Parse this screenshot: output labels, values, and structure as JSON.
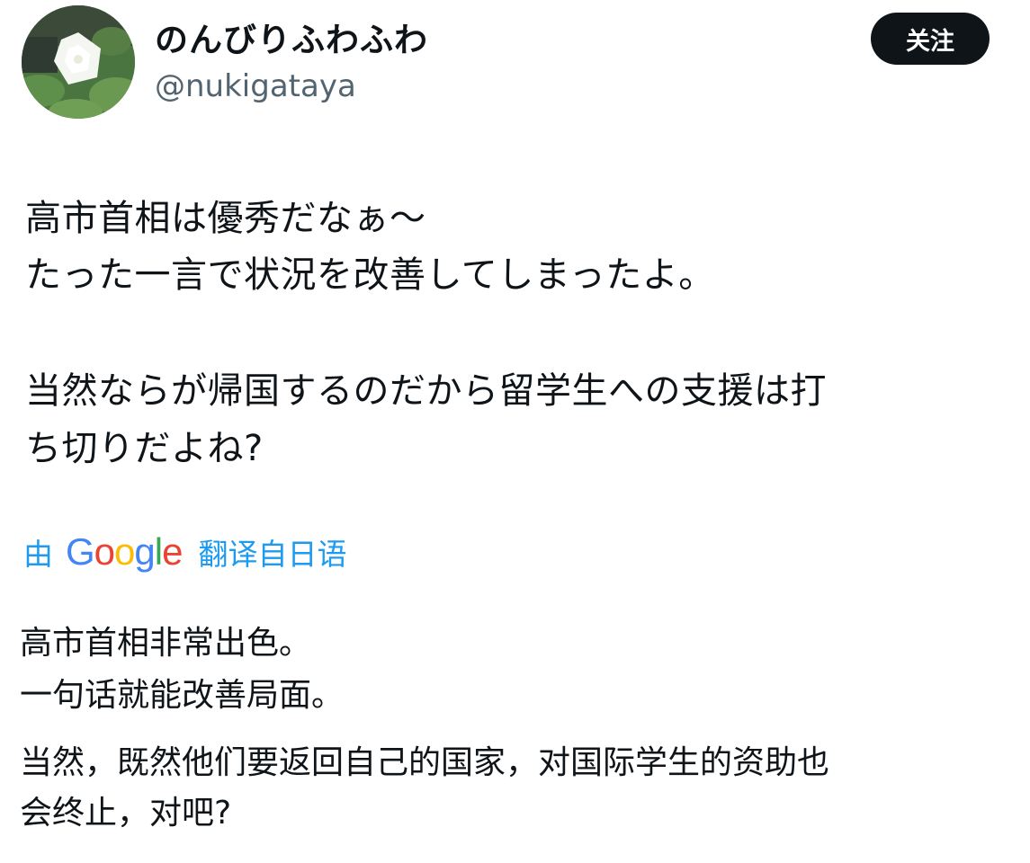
{
  "user": {
    "display_name": "のんびりふわふわ",
    "handle": "@nukigataya"
  },
  "follow_button": {
    "label": "关注"
  },
  "tweet": {
    "lines": [
      "高市首相は優秀だなぁ～",
      "たった一言で状況を改善してしまったよ。",
      "当然ならが帰国するのだから留学生への支援は打",
      "ち切りだよね?"
    ]
  },
  "translation": {
    "prefix": "由",
    "provider": {
      "letters": [
        "G",
        "o",
        "o",
        "g",
        "l",
        "e"
      ],
      "colors": [
        "#4285F4",
        "#EA4335",
        "#FBBC05",
        "#4285F4",
        "#34A853",
        "#EA4335"
      ]
    },
    "suffix": "翻译自日语",
    "lines": [
      "高市首相非常出色。",
      "一句话就能改善局面。",
      "当然，既然他们要返回自己的国家，对国际学生的资助也",
      "会终止，对吧?"
    ]
  }
}
